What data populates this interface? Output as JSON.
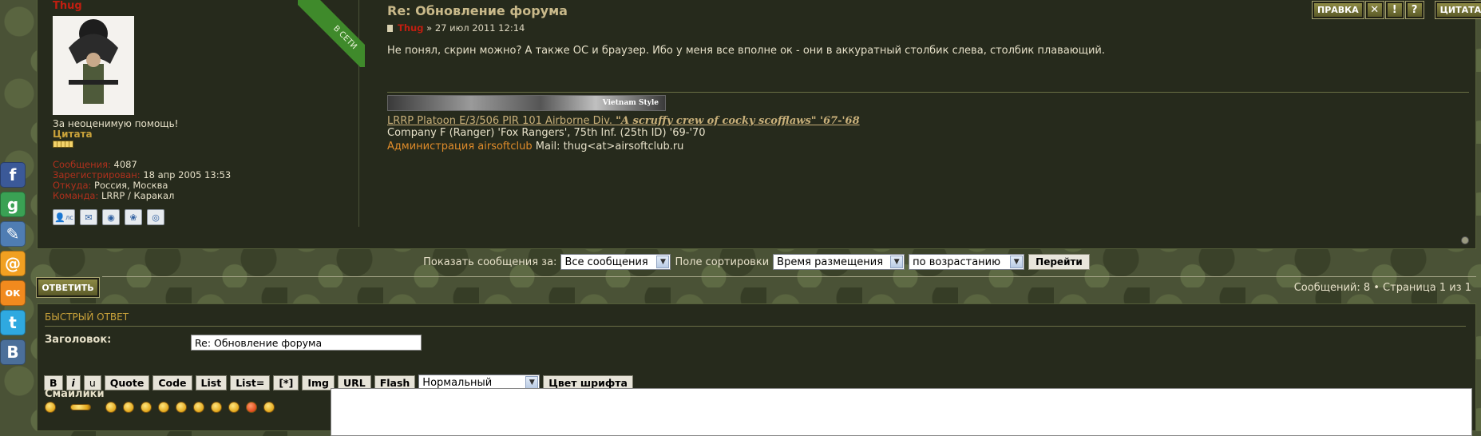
{
  "post": {
    "author": "Thug",
    "online_label": "В СЕТИ",
    "profile": {
      "thanks": "За неоценимую помощь!",
      "rank": "Цитата",
      "stats": [
        {
          "key": "Сообщения:",
          "value": "4087"
        },
        {
          "key": "Зарегистрирован:",
          "value": "18 апр 2005 13:53"
        },
        {
          "key": "Откуда:",
          "value": "Россия, Москва"
        },
        {
          "key": "Команда:",
          "value": "LRRP / Каракал"
        }
      ],
      "icons": [
        "user-pm-icon",
        "email-icon",
        "website-icon",
        "icq-icon",
        "skype-icon"
      ],
      "icon_glyphs": [
        "👤",
        "✉",
        "◉",
        "❀",
        "◎"
      ],
      "pm_label": "лс"
    },
    "title": "Re: Обновление форума",
    "meta_author": "Thug",
    "meta_sep": "»",
    "date": "27 июл 2011 12:14",
    "body": "Не понял, скрин можно? А также ОС и браузер. Ибо у меня все вполне ок - они в аккуратный столбик слева, столбик плавающий.",
    "signature": {
      "banner_text": "Vietnam Style",
      "line1_link": "LRRP Platoon E/3/506 PIR 101 Airborne Div.",
      "line1_quote": "\"A scruffy crew of cocky scofflaws\" '67-'68",
      "line2": "Company F (Ranger) 'Fox Rangers', 75th Inf. (25th ID) '69-'70",
      "line3_admin": "Администрация airsoftclub",
      "line3_rest": " Mail: thug<at>airsoftclub.ru"
    },
    "buttons": {
      "edit": "ПРАВКА",
      "delete": "✕",
      "report": "!",
      "info": "?",
      "quote": "ЦИТАТА"
    }
  },
  "sortbar": {
    "show_label": "Показать сообщения за:",
    "show_value": "Все сообщения",
    "sort_label": "Поле сортировки",
    "sort_value": "Время размещения",
    "order_value": "по возрастанию",
    "go": "Перейти"
  },
  "replybar": {
    "reply": "ОТВЕТИТЬ",
    "page_status": "Сообщений: 8 • Страница 1 из 1"
  },
  "quick_reply": {
    "title": "БЫСТРЫЙ ОТВЕТ",
    "subject_label": "Заголовок:",
    "subject_value": "Re: Обновление форума",
    "toolbar": [
      "B",
      "i",
      "u",
      "Quote",
      "Code",
      "List",
      "List=",
      "[*]",
      "Img",
      "URL",
      "Flash"
    ],
    "font_size_value": "Нормальный",
    "font_color": "Цвет шрифта",
    "smilies_label": "Смайлики"
  },
  "social": [
    {
      "name": "facebook-icon",
      "glyph": "f",
      "color": "#3b5998"
    },
    {
      "name": "google-icon",
      "glyph": "g",
      "color": "#3aa154"
    },
    {
      "name": "livejournal-icon",
      "glyph": "✎",
      "color": "#4f7db3"
    },
    {
      "name": "mailru-icon",
      "glyph": "@",
      "color": "#f1a021"
    },
    {
      "name": "odnoklassniki-icon",
      "glyph": "ок",
      "color": "#f18a1e"
    },
    {
      "name": "twitter-icon",
      "glyph": "t",
      "color": "#2fa9e0"
    },
    {
      "name": "vkontakte-icon",
      "glyph": "B",
      "color": "#4b6f9a"
    }
  ]
}
